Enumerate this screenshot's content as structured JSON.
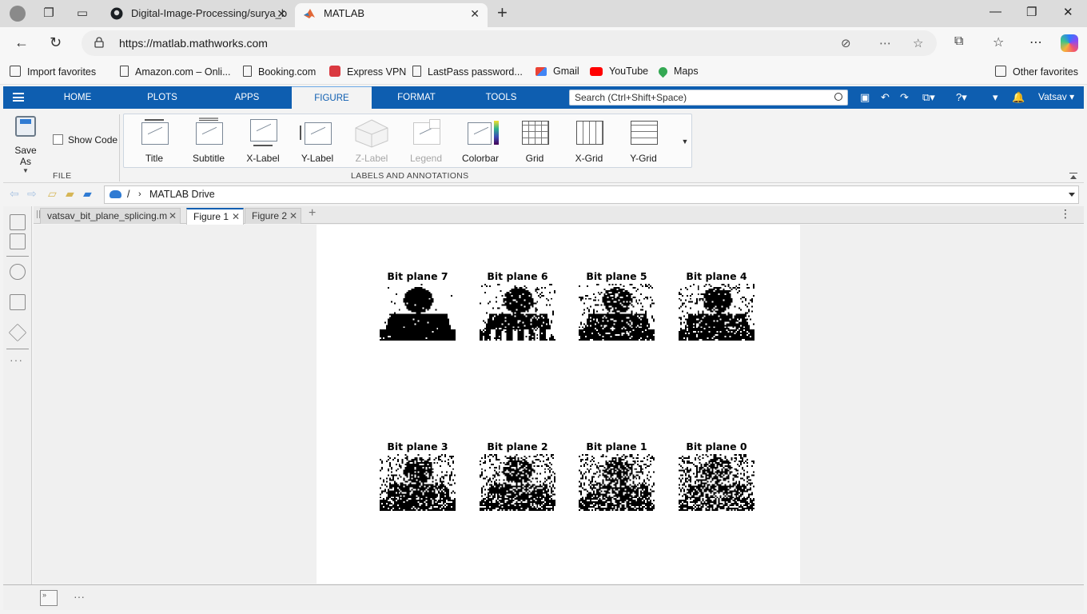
{
  "browser": {
    "tabs": [
      {
        "title": "Digital-Image-Processing/surya_b"
      },
      {
        "title": "MATLAB"
      }
    ],
    "url": "https://matlab.mathworks.com",
    "favorites": [
      {
        "label": "Import favorites",
        "icon": "import-icon"
      },
      {
        "label": "Amazon.com – Onli...",
        "icon": "page-icon"
      },
      {
        "label": "Booking.com",
        "icon": "page-icon"
      },
      {
        "label": "Express VPN",
        "icon": "expressvpn-icon"
      },
      {
        "label": "LastPass password...",
        "icon": "page-icon"
      },
      {
        "label": "Gmail",
        "icon": "gmail-icon"
      },
      {
        "label": "YouTube",
        "icon": "youtube-icon"
      },
      {
        "label": "Maps",
        "icon": "maps-icon"
      }
    ],
    "other_favorites": "Other favorites"
  },
  "matlab": {
    "tabs": [
      "HOME",
      "PLOTS",
      "APPS",
      "FIGURE",
      "FORMAT",
      "TOOLS"
    ],
    "selected_tab": "FIGURE",
    "search_placeholder": "Search (Ctrl+Shift+Space)",
    "user": "Vatsav",
    "ribbon": {
      "save_as": "Save As",
      "show_code": "Show Code",
      "file_group": "FILE",
      "labels_group": "LABELS AND ANNOTATIONS",
      "buttons": [
        {
          "label": "Title",
          "icon": "title-icon",
          "enabled": true
        },
        {
          "label": "Subtitle",
          "icon": "subtitle-icon",
          "enabled": true
        },
        {
          "label": "X-Label",
          "icon": "xlabel-icon",
          "enabled": true
        },
        {
          "label": "Y-Label",
          "icon": "ylabel-icon",
          "enabled": true
        },
        {
          "label": "Z-Label",
          "icon": "zlabel-icon",
          "enabled": false
        },
        {
          "label": "Legend",
          "icon": "legend-icon",
          "enabled": false
        },
        {
          "label": "Colorbar",
          "icon": "colorbar-icon",
          "enabled": true
        },
        {
          "label": "Grid",
          "icon": "grid-icon",
          "enabled": true
        },
        {
          "label": "X-Grid",
          "icon": "xgrid-icon",
          "enabled": true
        },
        {
          "label": "Y-Grid",
          "icon": "ygrid-icon",
          "enabled": true
        }
      ]
    },
    "path": {
      "root": "/",
      "folder": "MATLAB Drive"
    },
    "doc_tabs": [
      {
        "label": "vatsav_bit_plane_splicing.m",
        "selected": false
      },
      {
        "label": "Figure 1",
        "selected": true
      },
      {
        "label": "Figure 2",
        "selected": false
      }
    ],
    "figure": {
      "subplots": [
        {
          "title": "Bit plane 7",
          "bit": 7
        },
        {
          "title": "Bit plane 6",
          "bit": 6
        },
        {
          "title": "Bit plane 5",
          "bit": 5
        },
        {
          "title": "Bit plane 4",
          "bit": 4
        },
        {
          "title": "Bit plane 3",
          "bit": 3
        },
        {
          "title": "Bit plane 2",
          "bit": 2
        },
        {
          "title": "Bit plane 1",
          "bit": 1
        },
        {
          "title": "Bit plane 0",
          "bit": 0
        }
      ]
    }
  },
  "colors": {
    "matlab_blue": "#0e5eb0",
    "background": "#f3f3f3"
  }
}
